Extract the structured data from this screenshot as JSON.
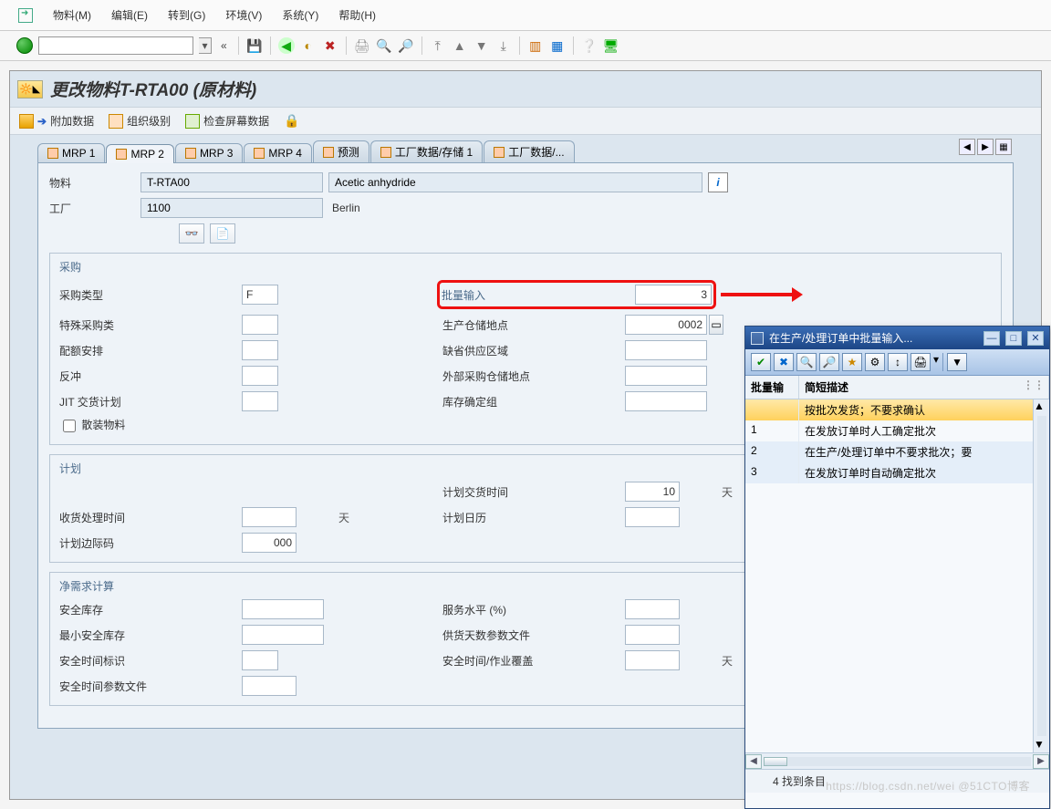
{
  "menu": {
    "items": [
      "物料(M)",
      "编辑(E)",
      "转到(G)",
      "环境(V)",
      "系统(Y)",
      "帮助(H)"
    ]
  },
  "page": {
    "title": "更改物料T-RTA00 (原材料)"
  },
  "subtoolbar": {
    "additional": "附加数据",
    "orglevel": "组织级别",
    "checkscreen": "检查屏幕数据"
  },
  "tabs": [
    "MRP 1",
    "MRP 2",
    "MRP 3",
    "MRP 4",
    "预测",
    "工厂数据/存储 1",
    "工厂数据/..."
  ],
  "active_tab_index": 1,
  "header": {
    "material_label": "物料",
    "material": "T-RTA00",
    "description": "Acetic anhydride",
    "plant_label": "工厂",
    "plant": "1100",
    "plant_name": "Berlin"
  },
  "groups": {
    "procurement": {
      "title": "采购",
      "proc_type_label": "采购类型",
      "proc_type": "F",
      "batch_entry_label": "批量输入",
      "batch_entry": "3",
      "special_label": "特殊采购类",
      "prod_loc_label": "生产仓储地点",
      "prod_loc": "0002",
      "quota_label": "配额安排",
      "default_area_label": "缺省供应区域",
      "backflush_label": "反冲",
      "ext_loc_label": "外部采购仓储地点",
      "jit_label": "JIT 交货计划",
      "stock_grp_label": "库存确定组",
      "bulk_label": "散装物料"
    },
    "scheduling": {
      "title": "计划",
      "plan_deliv_label": "计划交货时间",
      "plan_deliv": "10",
      "plan_deliv_unit": "天",
      "gr_time_label": "收货处理时间",
      "gr_time_unit": "天",
      "plan_cal_label": "计划日历",
      "margin_label": "计划边际码",
      "margin": "000"
    },
    "netreq": {
      "title": "净需求计算",
      "safety_label": "安全库存",
      "service_label": "服务水平 (%)",
      "minsafety_label": "最小安全库存",
      "cov_profile_label": "供货天数参数文件",
      "safetime_ind_label": "安全时间标识",
      "safetime_ov_label": "安全时间/作业覆盖",
      "safetime_ov_unit": "天",
      "safetime_prof_label": "安全时间参数文件"
    }
  },
  "popup": {
    "title": "在生产/处理订单中批量输入...",
    "col1": "批量输",
    "col2": "简短描述",
    "rows": [
      {
        "key": "",
        "desc": "按批次发货；不要求确认"
      },
      {
        "key": "1",
        "desc": "在发放订单时人工确定批次"
      },
      {
        "key": "2",
        "desc": "在生产/处理订单中不要求批次；要"
      },
      {
        "key": "3",
        "desc": "在发放订单时自动确定批次"
      }
    ],
    "status": "4 找到条目"
  },
  "watermark": "https://blog.csdn.net/wei @51CTO博客"
}
